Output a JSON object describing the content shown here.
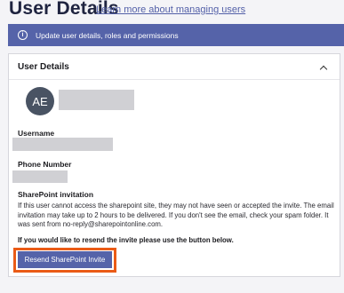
{
  "header": {
    "title": "User Details",
    "learn_link": "Learn more about managing users"
  },
  "banner": {
    "icon": "info-icon",
    "text": "Update user details, roles and permissions"
  },
  "card": {
    "title": "User Details",
    "collapse_icon": "chevron-up-icon",
    "avatar_initials": "AE",
    "username_label": "Username",
    "phone_label": "Phone Number",
    "sharepoint_label": "SharePoint invitation",
    "sharepoint_text": "If this user cannot access the sharepoint site, they may not have seen or accepted the invite. The email invitation may take up to 2 hours to be delivered. If you don't see the email, check your spam folder. It was sent from no-reply@sharepointonline.com.",
    "resend_prompt": "If you would like to resend the invite please use the button below.",
    "resend_button": "Resend SharePoint Invite"
  },
  "colors": {
    "accent": "#5563a9",
    "highlight": "#ea5b16",
    "avatar_bg": "#495363"
  }
}
